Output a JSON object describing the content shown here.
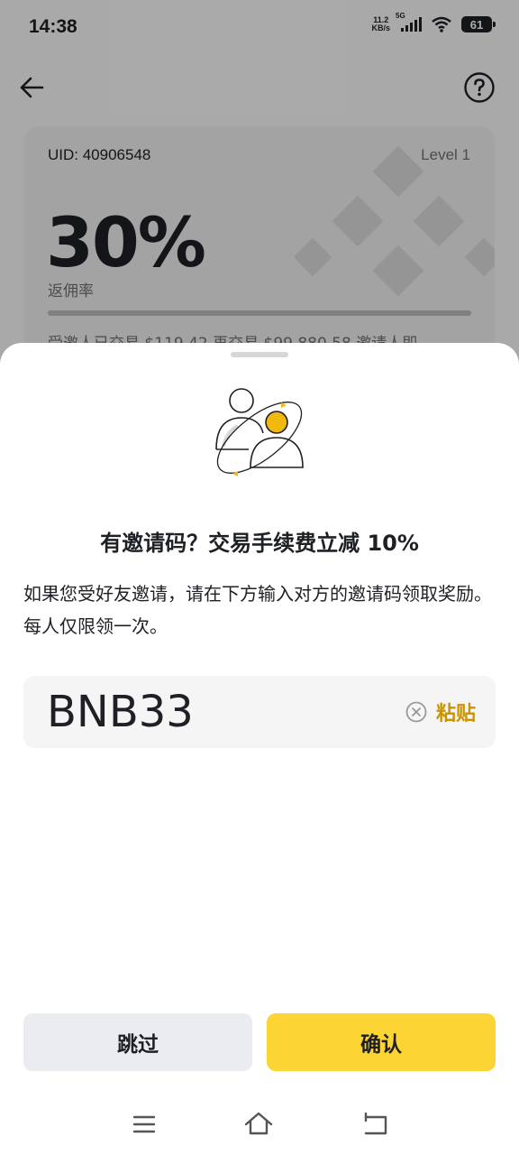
{
  "status_bar": {
    "time": "14:38",
    "net_speed_value": "11.2",
    "net_speed_unit": "KB/s",
    "network_type": "5G",
    "battery": "61"
  },
  "header": {
    "back_icon": "arrow-left-icon",
    "help_icon": "question-circle-icon"
  },
  "card": {
    "uid": "UID: 40906548",
    "level": "Level 1",
    "rate": "30%",
    "rate_label": "返佣率",
    "stats": "受邀人已交易 $119.42    再交易 $99,880.58    邀请人即"
  },
  "sheet": {
    "title": "有邀请码？交易手续费立减 10%",
    "description": "如果您受好友邀请，请在下方输入对方的邀请码领取奖励。每人仅限领一次。",
    "code_value": "BNB33",
    "paste_label": "粘贴",
    "skip_label": "跳过",
    "confirm_label": "确认"
  },
  "colors": {
    "accent": "#fcd535",
    "accent_text": "#c99400",
    "text": "#1e2026"
  }
}
